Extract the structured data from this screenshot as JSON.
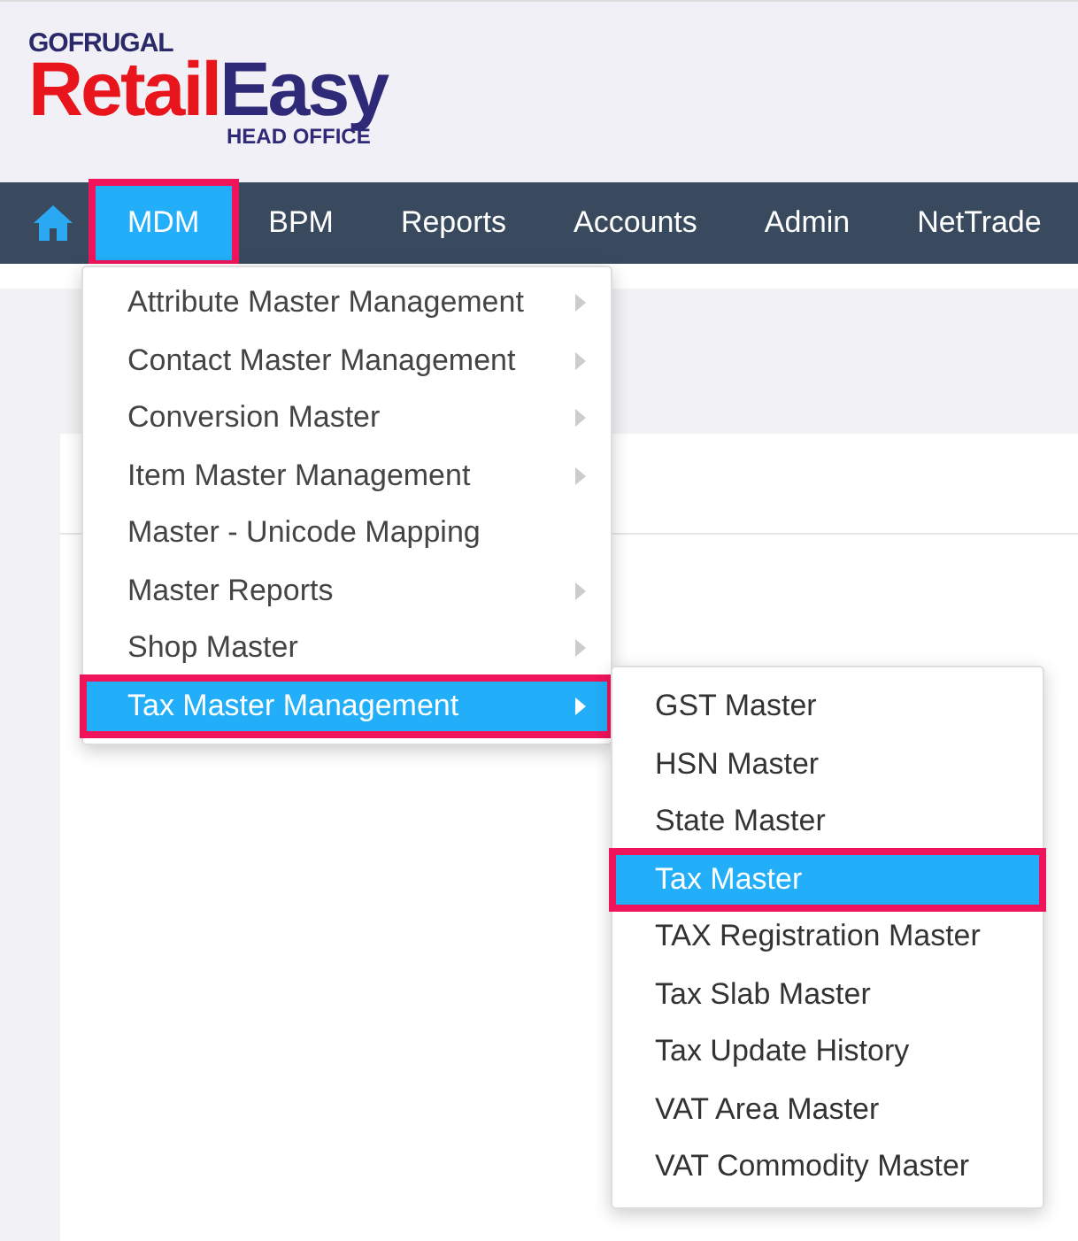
{
  "logo": {
    "company": "GOFRUGAL",
    "product_first": "Retail",
    "product_second": "Easy",
    "edition": "HEAD OFFICE"
  },
  "nav": [
    {
      "label": "MDM",
      "selected": true
    },
    {
      "label": "BPM",
      "selected": false
    },
    {
      "label": "Reports",
      "selected": false
    },
    {
      "label": "Accounts",
      "selected": false
    },
    {
      "label": "Admin",
      "selected": false
    },
    {
      "label": "NetTrade",
      "selected": false
    }
  ],
  "menu": [
    {
      "label": "Attribute Master Management",
      "has_submenu": true,
      "selected": false
    },
    {
      "label": "Contact Master Management",
      "has_submenu": true,
      "selected": false
    },
    {
      "label": "Conversion Master",
      "has_submenu": true,
      "selected": false
    },
    {
      "label": "Item Master Management",
      "has_submenu": true,
      "selected": false
    },
    {
      "label": "Master - Unicode Mapping",
      "has_submenu": false,
      "selected": false
    },
    {
      "label": "Master Reports",
      "has_submenu": true,
      "selected": false
    },
    {
      "label": "Shop Master",
      "has_submenu": true,
      "selected": false
    },
    {
      "label": "Tax Master Management",
      "has_submenu": true,
      "selected": true
    }
  ],
  "submenu": [
    {
      "label": "GST Master",
      "selected": false
    },
    {
      "label": "HSN Master",
      "selected": false
    },
    {
      "label": "State Master",
      "selected": false
    },
    {
      "label": "Tax Master",
      "selected": true
    },
    {
      "label": "TAX Registration Master",
      "selected": false
    },
    {
      "label": "Tax Slab Master",
      "selected": false
    },
    {
      "label": "Tax Update History",
      "selected": false
    },
    {
      "label": "VAT Area Master",
      "selected": false
    },
    {
      "label": "VAT Commodity Master",
      "selected": false
    }
  ]
}
